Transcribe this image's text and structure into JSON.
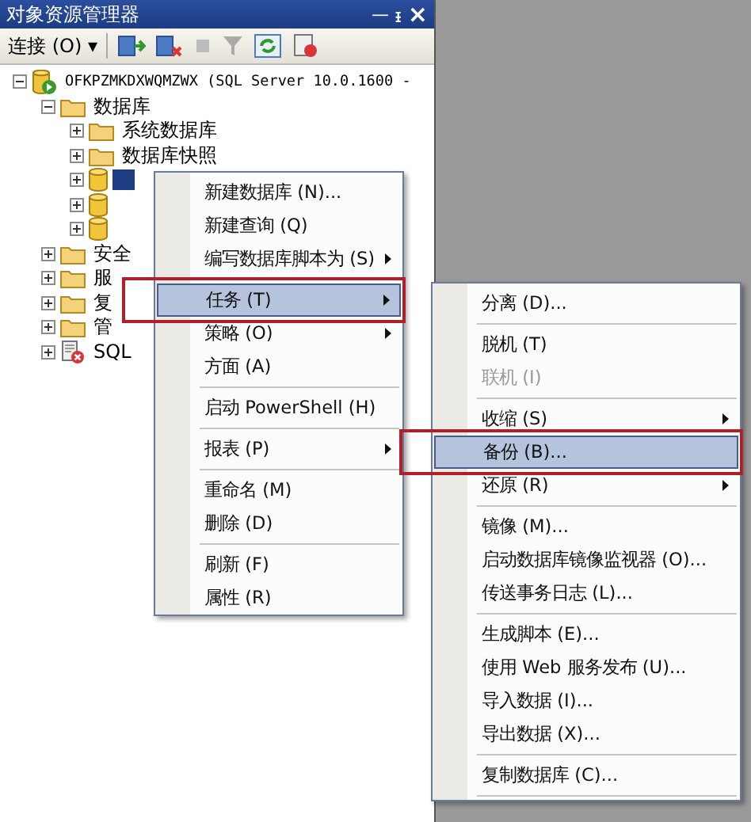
{
  "window": {
    "title": "对象资源管理器",
    "pin": "ᅳ ᵻ",
    "close": "×"
  },
  "toolbar": {
    "connect": "连接 (O) ▾"
  },
  "tree": [
    {
      "kind": "server",
      "label": "OFKPZMKDXWQMZWX (SQL Server 10.0.1600 -",
      "expanded": true,
      "selected": false,
      "children": [
        {
          "kind": "folder",
          "label": "数据库",
          "expanded": true,
          "selected": false,
          "children": [
            {
              "kind": "folder",
              "label": "系统数据库",
              "expanded": false,
              "selected": false
            },
            {
              "kind": "folder",
              "label": "数据库快照",
              "expanded": false,
              "selected": false
            },
            {
              "kind": "database",
              "expanded": false,
              "selected": true
            },
            {
              "kind": "database",
              "expanded": false,
              "selected": false
            },
            {
              "kind": "database",
              "expanded": false,
              "selected": false
            }
          ]
        },
        {
          "kind": "folder",
          "label": "安全",
          "expanded": false,
          "selected": false
        },
        {
          "kind": "folder",
          "label": "服",
          "expanded": false,
          "selected": false
        },
        {
          "kind": "folder",
          "label": "复",
          "expanded": false,
          "selected": false
        },
        {
          "kind": "folder",
          "label": "管",
          "expanded": false,
          "selected": false
        },
        {
          "kind": "agent",
          "label": "SQL",
          "expanded": false,
          "selected": false
        }
      ]
    }
  ],
  "context_menu": {
    "items": [
      {
        "kind": "item",
        "label": "新建数据库 (N)...",
        "submenu": false,
        "selected": false,
        "disabled": false,
        "outlined": false
      },
      {
        "kind": "item",
        "label": "新建查询 (Q)",
        "submenu": false,
        "selected": false,
        "disabled": false,
        "outlined": false
      },
      {
        "kind": "item",
        "label": "编写数据库脚本为 (S)",
        "submenu": true,
        "selected": false,
        "disabled": false,
        "outlined": false
      },
      {
        "kind": "separator"
      },
      {
        "kind": "item",
        "label": "任务 (T)",
        "submenu": true,
        "selected": true,
        "disabled": false,
        "outlined": true
      },
      {
        "kind": "item",
        "label": "策略 (O)",
        "submenu": true,
        "selected": false,
        "disabled": false,
        "outlined": false
      },
      {
        "kind": "item",
        "label": "方面 (A)",
        "submenu": false,
        "selected": false,
        "disabled": false,
        "outlined": false
      },
      {
        "kind": "separator"
      },
      {
        "kind": "item",
        "label": "启动 PowerShell (H)",
        "submenu": false,
        "selected": false,
        "disabled": false,
        "outlined": false
      },
      {
        "kind": "separator"
      },
      {
        "kind": "item",
        "label": "报表 (P)",
        "submenu": true,
        "selected": false,
        "disabled": false,
        "outlined": false
      },
      {
        "kind": "separator"
      },
      {
        "kind": "item",
        "label": "重命名 (M)",
        "submenu": false,
        "selected": false,
        "disabled": false,
        "outlined": false
      },
      {
        "kind": "item",
        "label": "删除 (D)",
        "submenu": false,
        "selected": false,
        "disabled": false,
        "outlined": false
      },
      {
        "kind": "separator"
      },
      {
        "kind": "item",
        "label": "刷新 (F)",
        "submenu": false,
        "selected": false,
        "disabled": false,
        "outlined": false
      },
      {
        "kind": "item",
        "label": "属性 (R)",
        "submenu": false,
        "selected": false,
        "disabled": false,
        "outlined": false
      }
    ]
  },
  "submenu": {
    "items": [
      {
        "kind": "item",
        "label": "分离 (D)...",
        "submenu": false,
        "selected": false,
        "disabled": false,
        "outlined": false
      },
      {
        "kind": "separator"
      },
      {
        "kind": "item",
        "label": "脱机 (T)",
        "submenu": false,
        "selected": false,
        "disabled": false,
        "outlined": false
      },
      {
        "kind": "item",
        "label": "联机 (I)",
        "submenu": false,
        "selected": false,
        "disabled": true,
        "outlined": false
      },
      {
        "kind": "separator"
      },
      {
        "kind": "item",
        "label": "收缩 (S)",
        "submenu": true,
        "selected": false,
        "disabled": false,
        "outlined": false
      },
      {
        "kind": "item",
        "label": "备份 (B)...",
        "submenu": false,
        "selected": true,
        "disabled": false,
        "outlined": true
      },
      {
        "kind": "item",
        "label": "还原 (R)",
        "submenu": true,
        "selected": false,
        "disabled": false,
        "outlined": false
      },
      {
        "kind": "separator"
      },
      {
        "kind": "item",
        "label": "镜像 (M)...",
        "submenu": false,
        "selected": false,
        "disabled": false,
        "outlined": false
      },
      {
        "kind": "item",
        "label": "启动数据库镜像监视器 (O)...",
        "submenu": false,
        "selected": false,
        "disabled": false,
        "outlined": false
      },
      {
        "kind": "item",
        "label": "传送事务日志 (L)...",
        "submenu": false,
        "selected": false,
        "disabled": false,
        "outlined": false
      },
      {
        "kind": "separator"
      },
      {
        "kind": "item",
        "label": "生成脚本 (E)...",
        "submenu": false,
        "selected": false,
        "disabled": false,
        "outlined": false
      },
      {
        "kind": "item",
        "label": "使用 Web 服务发布 (U)...",
        "submenu": false,
        "selected": false,
        "disabled": false,
        "outlined": false
      },
      {
        "kind": "item",
        "label": "导入数据 (I)...",
        "submenu": false,
        "selected": false,
        "disabled": false,
        "outlined": false
      },
      {
        "kind": "item",
        "label": "导出数据 (X)...",
        "submenu": false,
        "selected": false,
        "disabled": false,
        "outlined": false
      },
      {
        "kind": "separator"
      },
      {
        "kind": "item",
        "label": "复制数据库 (C)...",
        "submenu": false,
        "selected": false,
        "disabled": false,
        "outlined": false
      },
      {
        "kind": "separator"
      }
    ]
  }
}
